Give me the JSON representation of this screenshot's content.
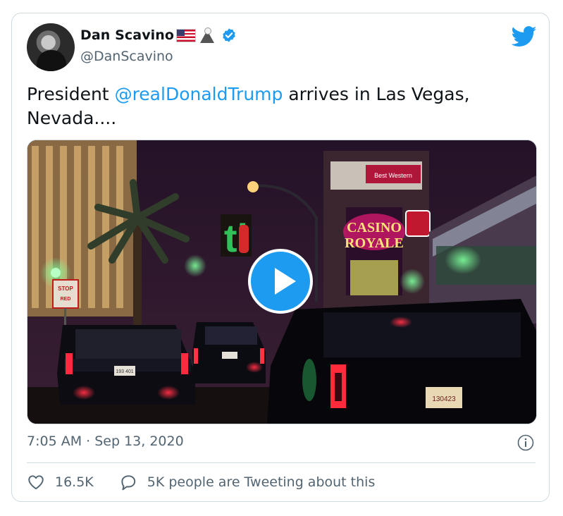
{
  "tweet": {
    "display_name": "Dan Scavino",
    "handle": "@DanScavino",
    "text_before": "President ",
    "mention": "@realDonaldTrump",
    "text_after": " arrives in Las Vegas, Nevada....",
    "timestamp": "7:05 AM · Sep 13, 2020",
    "likes": "16.5K",
    "conversation": "5K people are Tweeting about this"
  },
  "video_signs": {
    "stop_sign": "STOP",
    "stop_sign_sub": "RED",
    "casino_line1": "CASINO",
    "casino_line2": "ROYALE",
    "ti_logo": "ti",
    "best_western": "Best Western",
    "plate_left": "193 401",
    "plate_right": "130423"
  },
  "colors": {
    "accent": "#1d9bf0",
    "text": "#0f1419",
    "muted": "#536471",
    "border": "#cfd9de"
  },
  "icons": {
    "verified": "verified-badge-icon",
    "twitter": "twitter-bird-icon",
    "play": "play-icon",
    "info": "info-icon",
    "like": "heart-icon",
    "reply": "speech-bubble-icon"
  }
}
